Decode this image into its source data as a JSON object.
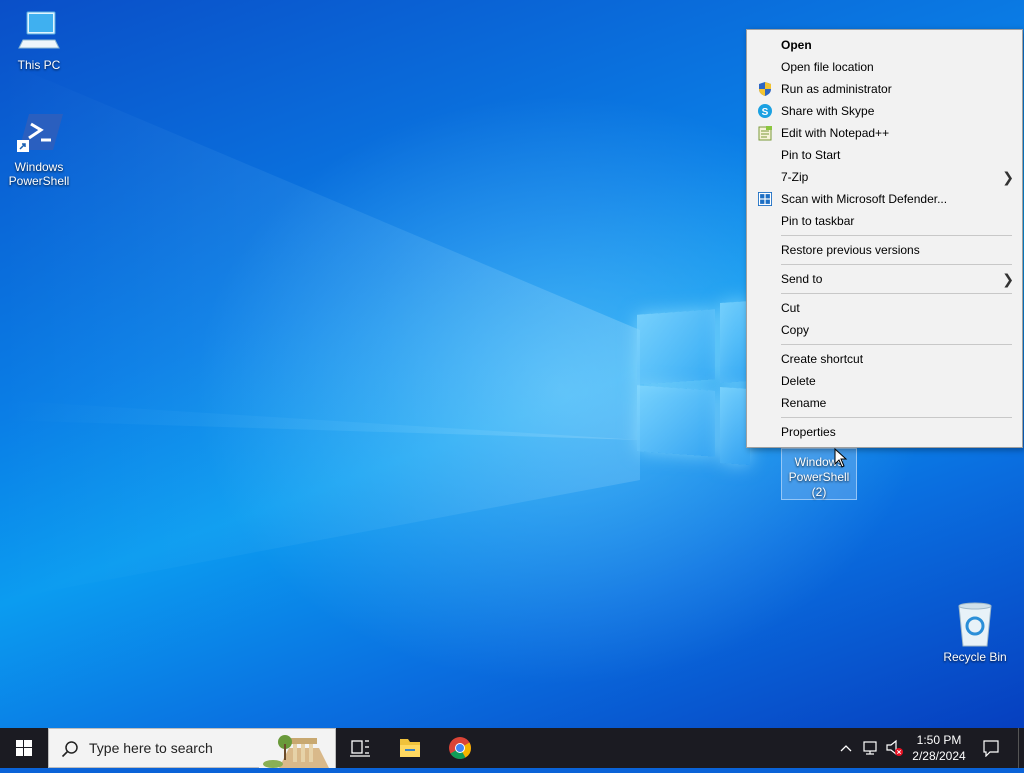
{
  "desktop": {
    "icons": [
      {
        "label": "This PC"
      },
      {
        "label": "Windows PowerShell"
      },
      {
        "label": "Recycle Bin"
      }
    ],
    "selected_icon": {
      "line1": "Windows",
      "line2": "PowerShell",
      "line3": "(2)"
    }
  },
  "context_menu": {
    "items": [
      {
        "label": "Open",
        "bold": true
      },
      {
        "label": "Open file location"
      },
      {
        "label": "Run as administrator",
        "icon": "uac-shield-icon"
      },
      {
        "label": "Share with Skype",
        "icon": "skype-icon"
      },
      {
        "label": "Edit with Notepad++",
        "icon": "notepadpp-icon"
      },
      {
        "label": "Pin to Start"
      },
      {
        "label": "7-Zip",
        "submenu": true
      },
      {
        "label": "Scan with Microsoft Defender...",
        "icon": "defender-icon"
      },
      {
        "label": "Pin to taskbar"
      },
      {
        "label": "Restore previous versions"
      },
      {
        "label": "Send to",
        "submenu": true
      },
      {
        "label": "Cut"
      },
      {
        "label": "Copy"
      },
      {
        "label": "Create shortcut"
      },
      {
        "label": "Delete"
      },
      {
        "label": "Rename"
      },
      {
        "label": "Properties"
      }
    ]
  },
  "taskbar": {
    "search_placeholder": "Type here to search",
    "clock_time": "1:50 PM",
    "clock_date": "2/28/2024"
  },
  "colors": {
    "taskbar": "#1b1b22",
    "menu_bg": "#f2f2f2",
    "selection": "#78b4f0"
  }
}
